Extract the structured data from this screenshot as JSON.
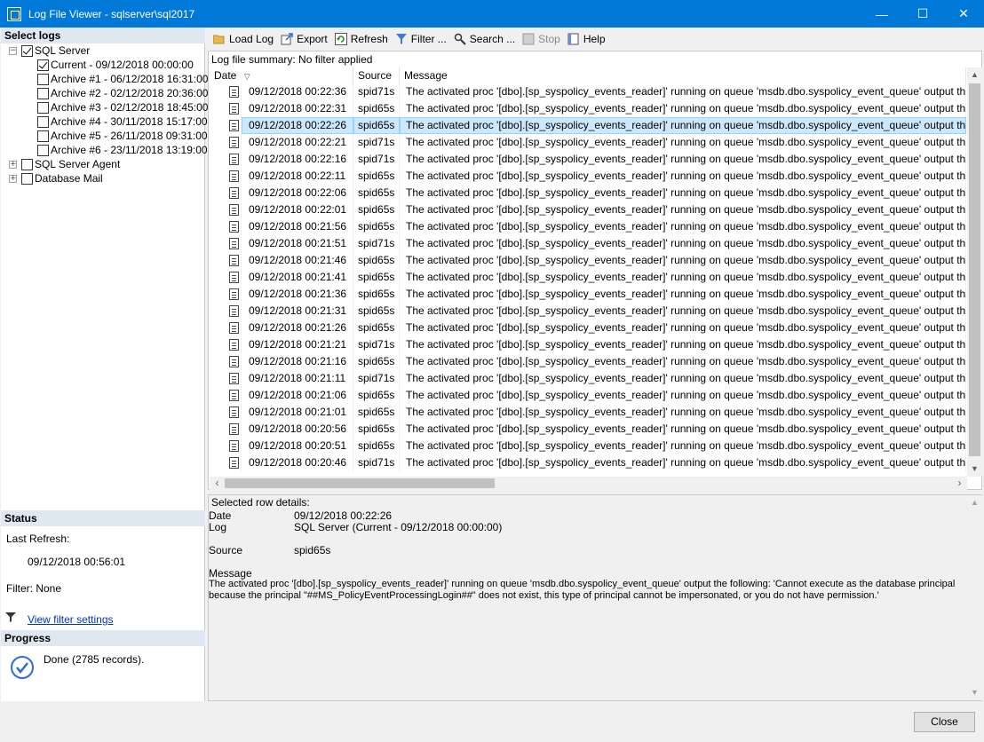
{
  "window": {
    "title": "Log File Viewer - sqlserver\\sql2017",
    "minimize": "—",
    "maximize": "☐",
    "close": "✕"
  },
  "select_logs": {
    "heading": "Select logs",
    "tree": [
      {
        "label": "SQL Server",
        "level": 0,
        "expander": "−",
        "checked": true
      },
      {
        "label": "Current - 09/12/2018 00:00:00",
        "level": 1,
        "checked": true
      },
      {
        "label": "Archive #1 - 06/12/2018 16:31:00",
        "level": 1,
        "checked": false
      },
      {
        "label": "Archive #2 - 02/12/2018 20:36:00",
        "level": 1,
        "checked": false
      },
      {
        "label": "Archive #3 - 02/12/2018 18:45:00",
        "level": 1,
        "checked": false
      },
      {
        "label": "Archive #4 - 30/11/2018 15:17:00",
        "level": 1,
        "checked": false
      },
      {
        "label": "Archive #5 - 26/11/2018 09:31:00",
        "level": 1,
        "checked": false
      },
      {
        "label": "Archive #6 - 23/11/2018 13:19:00",
        "level": 1,
        "checked": false
      },
      {
        "label": "SQL Server Agent",
        "level": 0,
        "expander": "+",
        "checked": false
      },
      {
        "label": "Database Mail",
        "level": 0,
        "expander": "+",
        "checked": false
      }
    ]
  },
  "status": {
    "heading": "Status",
    "last_refresh_label": "Last Refresh:",
    "last_refresh_value": "09/12/2018 00:56:01",
    "filter_text": "Filter: None",
    "view_filter_link": "View filter settings"
  },
  "progress": {
    "heading": "Progress",
    "text": "Done (2785 records)."
  },
  "toolbar": {
    "load_log": "Load Log",
    "export": "Export",
    "refresh": "Refresh",
    "filter": "Filter ...",
    "search": "Search ...",
    "stop": "Stop",
    "help": "Help"
  },
  "grid": {
    "summary": "Log file summary: No filter applied",
    "columns": {
      "date": "Date",
      "date_sort": "▽",
      "source": "Source",
      "message": "Message"
    },
    "selected_index": 2,
    "rows": [
      {
        "date": "09/12/2018 00:22:36",
        "source": "spid71s",
        "message": "The activated proc '[dbo].[sp_syspolicy_events_reader]' running on queue 'msdb.dbo.syspolicy_event_queue' output the following:  'Ca"
      },
      {
        "date": "09/12/2018 00:22:31",
        "source": "spid65s",
        "message": "The activated proc '[dbo].[sp_syspolicy_events_reader]' running on queue 'msdb.dbo.syspolicy_event_queue' output the following:  'Ca"
      },
      {
        "date": "09/12/2018 00:22:26",
        "source": "spid65s",
        "message": "The activated proc '[dbo].[sp_syspolicy_events_reader]' running on queue 'msdb.dbo.syspolicy_event_queue' output the following:  'Ca"
      },
      {
        "date": "09/12/2018 00:22:21",
        "source": "spid71s",
        "message": "The activated proc '[dbo].[sp_syspolicy_events_reader]' running on queue 'msdb.dbo.syspolicy_event_queue' output the following:  'Ca"
      },
      {
        "date": "09/12/2018 00:22:16",
        "source": "spid71s",
        "message": "The activated proc '[dbo].[sp_syspolicy_events_reader]' running on queue 'msdb.dbo.syspolicy_event_queue' output the following:  'Ca"
      },
      {
        "date": "09/12/2018 00:22:11",
        "source": "spid65s",
        "message": "The activated proc '[dbo].[sp_syspolicy_events_reader]' running on queue 'msdb.dbo.syspolicy_event_queue' output the following:  'Ca"
      },
      {
        "date": "09/12/2018 00:22:06",
        "source": "spid65s",
        "message": "The activated proc '[dbo].[sp_syspolicy_events_reader]' running on queue 'msdb.dbo.syspolicy_event_queue' output the following:  'Ca"
      },
      {
        "date": "09/12/2018 00:22:01",
        "source": "spid65s",
        "message": "The activated proc '[dbo].[sp_syspolicy_events_reader]' running on queue 'msdb.dbo.syspolicy_event_queue' output the following:  'Ca"
      },
      {
        "date": "09/12/2018 00:21:56",
        "source": "spid65s",
        "message": "The activated proc '[dbo].[sp_syspolicy_events_reader]' running on queue 'msdb.dbo.syspolicy_event_queue' output the following:  'Ca"
      },
      {
        "date": "09/12/2018 00:21:51",
        "source": "spid71s",
        "message": "The activated proc '[dbo].[sp_syspolicy_events_reader]' running on queue 'msdb.dbo.syspolicy_event_queue' output the following:  'Ca"
      },
      {
        "date": "09/12/2018 00:21:46",
        "source": "spid65s",
        "message": "The activated proc '[dbo].[sp_syspolicy_events_reader]' running on queue 'msdb.dbo.syspolicy_event_queue' output the following:  'Ca"
      },
      {
        "date": "09/12/2018 00:21:41",
        "source": "spid65s",
        "message": "The activated proc '[dbo].[sp_syspolicy_events_reader]' running on queue 'msdb.dbo.syspolicy_event_queue' output the following:  'Ca"
      },
      {
        "date": "09/12/2018 00:21:36",
        "source": "spid65s",
        "message": "The activated proc '[dbo].[sp_syspolicy_events_reader]' running on queue 'msdb.dbo.syspolicy_event_queue' output the following:  'Ca"
      },
      {
        "date": "09/12/2018 00:21:31",
        "source": "spid65s",
        "message": "The activated proc '[dbo].[sp_syspolicy_events_reader]' running on queue 'msdb.dbo.syspolicy_event_queue' output the following:  'Ca"
      },
      {
        "date": "09/12/2018 00:21:26",
        "source": "spid65s",
        "message": "The activated proc '[dbo].[sp_syspolicy_events_reader]' running on queue 'msdb.dbo.syspolicy_event_queue' output the following:  'Ca"
      },
      {
        "date": "09/12/2018 00:21:21",
        "source": "spid71s",
        "message": "The activated proc '[dbo].[sp_syspolicy_events_reader]' running on queue 'msdb.dbo.syspolicy_event_queue' output the following:  'Ca"
      },
      {
        "date": "09/12/2018 00:21:16",
        "source": "spid65s",
        "message": "The activated proc '[dbo].[sp_syspolicy_events_reader]' running on queue 'msdb.dbo.syspolicy_event_queue' output the following:  'Ca"
      },
      {
        "date": "09/12/2018 00:21:11",
        "source": "spid71s",
        "message": "The activated proc '[dbo].[sp_syspolicy_events_reader]' running on queue 'msdb.dbo.syspolicy_event_queue' output the following:  'Ca"
      },
      {
        "date": "09/12/2018 00:21:06",
        "source": "spid65s",
        "message": "The activated proc '[dbo].[sp_syspolicy_events_reader]' running on queue 'msdb.dbo.syspolicy_event_queue' output the following:  'Ca"
      },
      {
        "date": "09/12/2018 00:21:01",
        "source": "spid65s",
        "message": "The activated proc '[dbo].[sp_syspolicy_events_reader]' running on queue 'msdb.dbo.syspolicy_event_queue' output the following:  'Ca"
      },
      {
        "date": "09/12/2018 00:20:56",
        "source": "spid65s",
        "message": "The activated proc '[dbo].[sp_syspolicy_events_reader]' running on queue 'msdb.dbo.syspolicy_event_queue' output the following:  'Ca"
      },
      {
        "date": "09/12/2018 00:20:51",
        "source": "spid65s",
        "message": "The activated proc '[dbo].[sp_syspolicy_events_reader]' running on queue 'msdb.dbo.syspolicy_event_queue' output the following:  'Ca"
      },
      {
        "date": "09/12/2018 00:20:46",
        "source": "spid71s",
        "message": "The activated proc '[dbo].[sp_syspolicy_events_reader]' running on queue 'msdb.dbo.syspolicy_event_queue' output the following:  'Ca"
      }
    ]
  },
  "details": {
    "heading": "Selected row details:",
    "date_label": "Date",
    "date_value": "09/12/2018 00:22:26",
    "log_label": "Log",
    "log_value": "SQL Server (Current - 09/12/2018 00:00:00)",
    "source_label": "Source",
    "source_value": "spid65s",
    "message_label": "Message",
    "message_line1": "The activated proc '[dbo].[sp_syspolicy_events_reader]' running on queue 'msdb.dbo.syspolicy_event_queue' output the following:  'Cannot execute as the database principal",
    "message_line2": "because the principal \"##MS_PolicyEventProcessingLogin##\" does not exist, this type of principal cannot be impersonated, or you do not have permission.'"
  },
  "footer": {
    "close": "Close"
  },
  "icons": {
    "app": "log-viewer-icon",
    "load_log": "folder-open-icon",
    "export": "export-icon",
    "refresh": "refresh-icon",
    "filter": "funnel-icon",
    "search": "magnifier-icon",
    "stop": "stop-icon",
    "help": "help-book-icon",
    "done": "checkmark-circle-icon"
  },
  "colors": {
    "titlebar": "#0078d7",
    "selection": "#cce8ff",
    "section_header": "#dfe8f1",
    "link": "#0033cc"
  }
}
